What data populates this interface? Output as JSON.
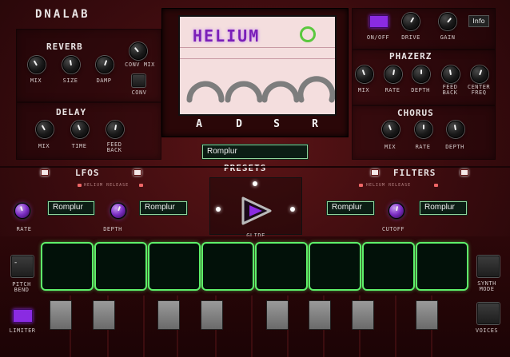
{
  "brand": "DNALAB",
  "display": {
    "logo": "HELIUM"
  },
  "reverb": {
    "title": "REVERB",
    "knobs": [
      "MIX",
      "SIZE",
      "DAMP"
    ],
    "conv_mix": "CONV MIX",
    "conv": "CONV"
  },
  "delay": {
    "title": "DELAY",
    "knobs": [
      "MIX",
      "TIME",
      "FEED\nBACK"
    ]
  },
  "master": {
    "onoff": "ON/OFF",
    "drive": "DRIVE",
    "gain": "GAIN",
    "info": "Info"
  },
  "phazerz": {
    "title": "PHAZERZ",
    "knobs": [
      "MIX",
      "RATE",
      "DEPTH",
      "FEED\nBACK",
      "CENTER\nFREQ"
    ]
  },
  "chorus": {
    "title": "CHORUS",
    "knobs": [
      "MIX",
      "RATE",
      "DEPTH"
    ]
  },
  "adsr": {
    "letters": [
      "A",
      "D",
      "S",
      "R"
    ]
  },
  "presets": {
    "title": "PRESETS",
    "current": "Romplur"
  },
  "lfos": {
    "title": "LFOS",
    "hint": "HELIUM RELEASE",
    "select1": "Romplur",
    "select2": "Romplur",
    "rate": "RATE",
    "depth": "DEPTH"
  },
  "filters": {
    "title": "FILTERS",
    "hint": "HELIUM RELEASE",
    "select1": "Romplur",
    "select2": "Romplur",
    "cutoff": "CUTOFF"
  },
  "glide": "GLIDE",
  "left": {
    "pitch_bend": "PITCH\nBEND",
    "pitch_value": "-",
    "limiter": "LIMITER"
  },
  "right": {
    "synth_mode": "SYNTH\nMODE",
    "voices": "VOICES"
  },
  "colors": {
    "accent_green": "#5ef06a",
    "accent_purple": "#8a2be2",
    "panel": "#3a0b0e"
  }
}
